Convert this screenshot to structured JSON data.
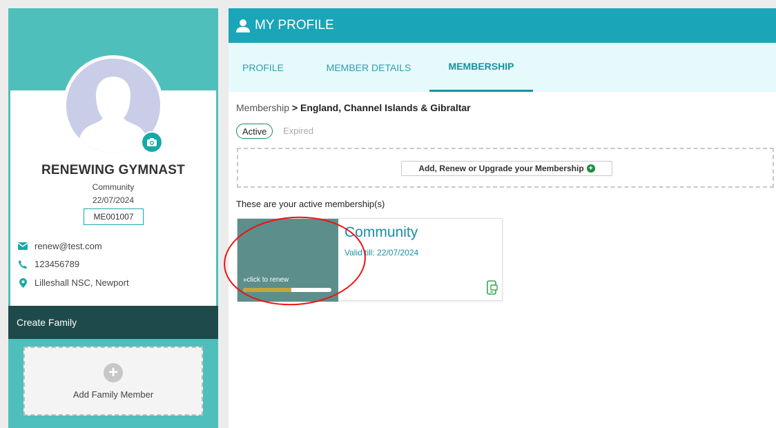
{
  "sidebar": {
    "name": "RENEWING GYMNAST",
    "membership_type": "Community",
    "membership_date": "22/07/2024",
    "member_id": "ME001007",
    "email": "renew@test.com",
    "phone": "123456789",
    "location": "Lilleshall NSC, Newport",
    "create_family_label": "Create Family",
    "add_family_member_label": "Add Family Member"
  },
  "header": {
    "title": "MY PROFILE"
  },
  "tabs": [
    {
      "label": "PROFILE",
      "active": false
    },
    {
      "label": "MEMBER DETAILS",
      "active": false
    },
    {
      "label": "MEMBERSHIP",
      "active": true
    }
  ],
  "breadcrumb": {
    "root": "Membership",
    "separator": ">",
    "current": "England, Channel Islands & Gibraltar"
  },
  "filters": {
    "active": "Active",
    "expired": "Expired"
  },
  "renew_button_label": "Add, Renew or Upgrade your Membership",
  "active_memberships_text": "These are your active membership(s)",
  "membership_card": {
    "title": "Community",
    "valid_till": "Valid till: 22/07/2024",
    "renew_text": "»click to renew",
    "renew_progress": 0.55
  },
  "colors": {
    "sidebar": "#4fbfbc",
    "header": "#1aa5b8",
    "tab_bg": "#e6fafc",
    "dark_bar": "#1e4a4b",
    "card_left": "#5c8e8b",
    "accent": "#1a8fa3",
    "annotation": "#e11111"
  },
  "icons": [
    "camera-icon",
    "email-icon",
    "phone-icon",
    "location-icon",
    "plus-icon",
    "user-icon",
    "plus-circle-icon",
    "mobile-card-icon"
  ]
}
